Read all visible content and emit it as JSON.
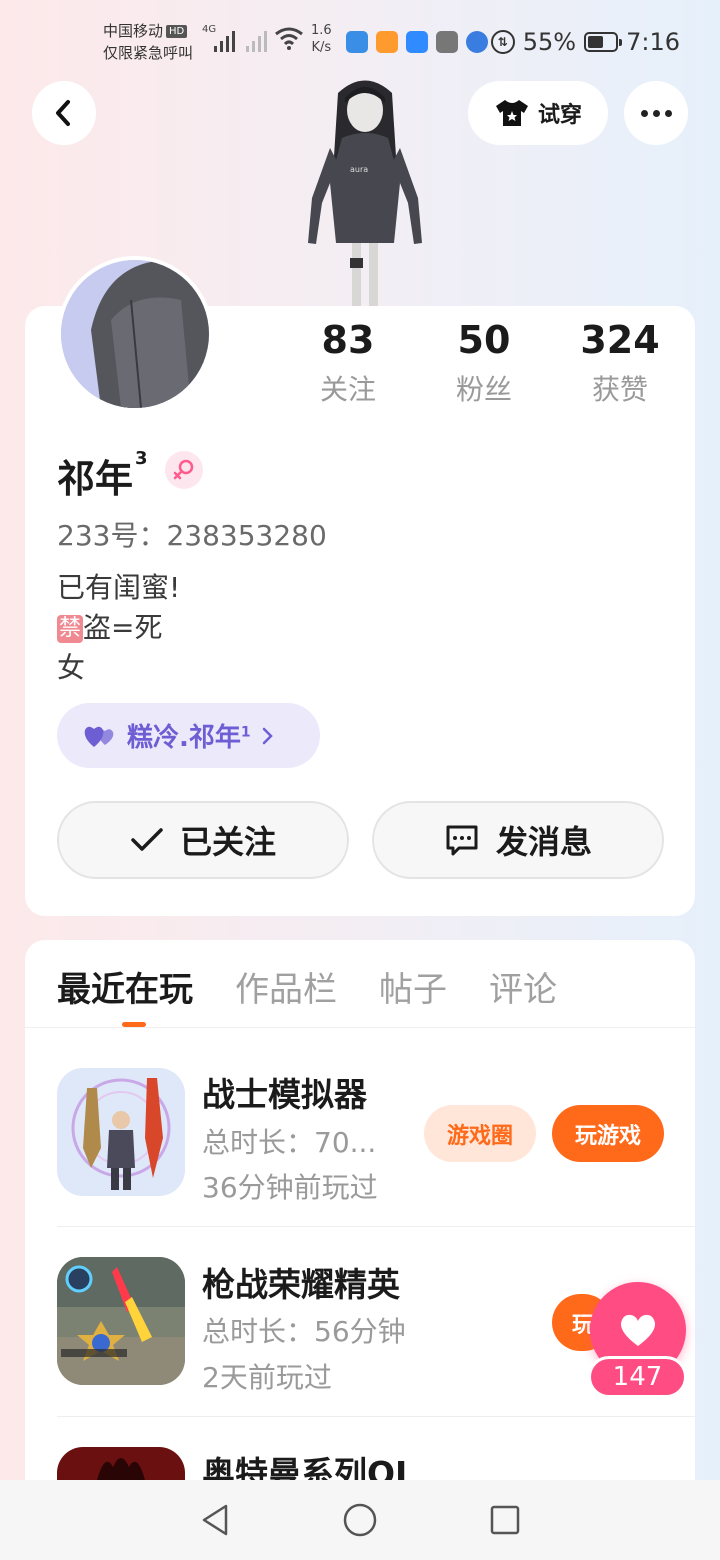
{
  "status_bar": {
    "carrier_line1": "中国移动",
    "hd_badge": "HD",
    "carrier_line2": "仅限紧急呼叫",
    "network_type": "4G",
    "speed_value": "1.6",
    "speed_unit": "K/s",
    "battery": "55%",
    "time": "7:16"
  },
  "top_bar": {
    "try_on_label": "试穿"
  },
  "profile": {
    "stats": [
      {
        "value": "83",
        "label": "关注"
      },
      {
        "value": "50",
        "label": "粉丝"
      },
      {
        "value": "324",
        "label": "获赞"
      }
    ],
    "name": "祁年",
    "name_superscript": "3",
    "id_text": "233号：238353280",
    "bio_line1": "已有闺蜜!",
    "bio_ban_badge": "禁",
    "bio_line2_rest": "盗=死",
    "bio_line3": "女",
    "bestie_name": "糕冷.祁年",
    "bestie_superscript": "1",
    "follow_label": "已关注",
    "message_label": "发消息"
  },
  "tabs": [
    {
      "label": "最近在玩",
      "active": true
    },
    {
      "label": "作品栏",
      "active": false
    },
    {
      "label": "帖子",
      "active": false
    },
    {
      "label": "评论",
      "active": false
    }
  ],
  "games": [
    {
      "name": "战士模拟器",
      "duration": "总时长：70...",
      "last_played": "36分钟前玩过",
      "circle_label": "游戏圈",
      "play_label": "玩游戏"
    },
    {
      "name": "枪战荣耀精英",
      "duration": "总时长：56分钟",
      "last_played": "2天前玩过",
      "play_label": "玩"
    },
    {
      "name": "奥特曼系列OL"
    }
  ],
  "like_count": "147",
  "colors": {
    "accent": "#ff6a1a",
    "like_pink": "#ff4d84",
    "bestie_purple": "#6e5ed4"
  }
}
